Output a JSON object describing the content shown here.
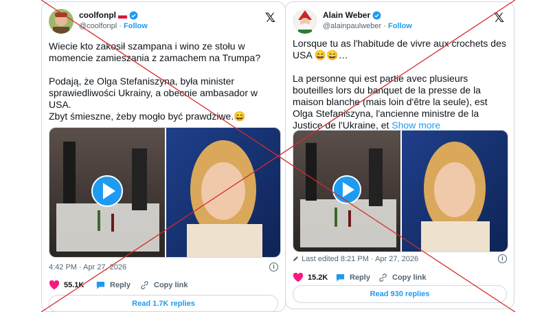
{
  "tweets": [
    {
      "name": "coolfonpl",
      "handle": "@coolfonpl",
      "follow": "Follow",
      "text": "Wiecie kto zakosił szampana i wino ze stołu w momencie zamieszania z zamachem na Trumpa?\n\nPodają, że Olga Stefaniszyna, była minister sprawiedliwości Ukrainy, a obecnie ambasador w USA.\nZbyt śmieszne, żeby mogło być prawdziwe.😄",
      "timestamp": "4:42 PM · Apr 27, 2026",
      "likes": "55.1K",
      "reply_label": "Reply",
      "copy_label": "Copy link",
      "read_replies": "Read 1.7K replies"
    },
    {
      "name": "Alain Weber",
      "handle": "@alainpaulweber",
      "follow": "Follow",
      "text": "Lorsque tu as l'habitude de vivre aux crochets des USA 😄😄…\n\nLa personne  qui est partie avec plusieurs bouteilles lors du banquet de la presse de la maison blanche (mais loin d'être la seule), est Olga Stefaniszyna, l'ancienne ministre de la Justice de l'Ukraine, et ",
      "show_more": "Show more",
      "timestamp": "Last edited 8:21 PM · Apr 27, 2026",
      "likes": "15.2K",
      "reply_label": "Reply",
      "copy_label": "Copy link",
      "read_replies": "Read 930 replies"
    }
  ],
  "icons": {
    "verified": "verified-badge-icon",
    "x_logo": "x-logo-icon",
    "heart": "heart-icon",
    "reply": "reply-bubble-icon",
    "link": "link-icon",
    "play": "play-icon",
    "info": "info-icon",
    "edit": "pencil-icon"
  },
  "colors": {
    "accent": "#1d9bf0",
    "like": "#f91880",
    "cross": "#d22b2b"
  }
}
